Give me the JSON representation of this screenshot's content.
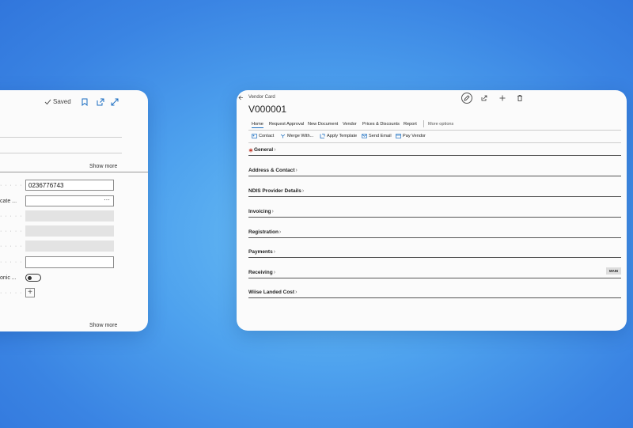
{
  "left_card": {
    "status": "Saved",
    "show_more_top": "Show more",
    "show_more_bottom": "Show more",
    "fields": [
      {
        "label": "",
        "value": "0236776743",
        "kind": "input"
      },
      {
        "label": "cate ...",
        "value": "",
        "kind": "lookup",
        "button": "···"
      },
      {
        "label": "",
        "value": "",
        "kind": "disabled"
      },
      {
        "label": "",
        "value": "",
        "kind": "disabled"
      },
      {
        "label": "",
        "value": "",
        "kind": "disabled"
      },
      {
        "label": "",
        "value": "",
        "kind": "input"
      },
      {
        "label": "onic ...",
        "value": "",
        "kind": "toggle"
      },
      {
        "label": "",
        "value": "",
        "kind": "add"
      }
    ]
  },
  "right_card": {
    "page_caption": "Vendor Card",
    "title": "V000001",
    "tabs": [
      "Home",
      "Request Approval",
      "New Document",
      "Vendor",
      "Prices & Discounts",
      "Report",
      "More options"
    ],
    "actions": [
      "Contact",
      "Merge With...",
      "Apply Template",
      "Send Email",
      "Pay Vendor"
    ],
    "sections": [
      {
        "title": "General",
        "required": true
      },
      {
        "title": "Address & Contact"
      },
      {
        "title": "NDIS Provider Details"
      },
      {
        "title": "Invoicing"
      },
      {
        "title": "Registration"
      },
      {
        "title": "Payments"
      },
      {
        "title": "Receiving",
        "badge": "MAIN"
      },
      {
        "title": "Wiise Landed Cost"
      }
    ]
  },
  "colors": {
    "accent": "#1b6ec2",
    "background_blue": "#4ea2ee",
    "required_marker": "#c0392b"
  }
}
